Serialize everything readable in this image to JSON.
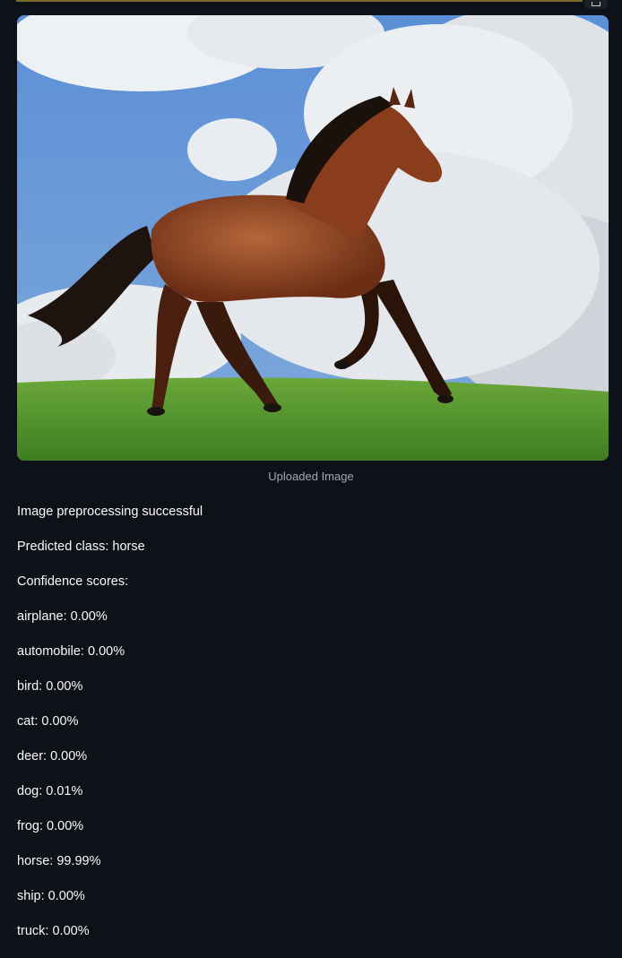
{
  "image": {
    "caption": "Uploaded Image",
    "icon": "horse-photo"
  },
  "status": {
    "preprocessing": "Image preprocessing successful",
    "predicted": "Predicted class: horse",
    "scores_header": "Confidence scores:"
  },
  "scores": [
    "airplane: 0.00%",
    "automobile: 0.00%",
    "bird: 0.00%",
    "cat: 0.00%",
    "deer: 0.00%",
    "dog: 0.01%",
    "frog: 0.00%",
    "horse: 99.99%",
    "ship: 0.00%",
    "truck: 0.00%"
  ],
  "colors": {
    "background": "#0e1117",
    "text": "#fafafa",
    "caption": "#a3a8b4"
  }
}
